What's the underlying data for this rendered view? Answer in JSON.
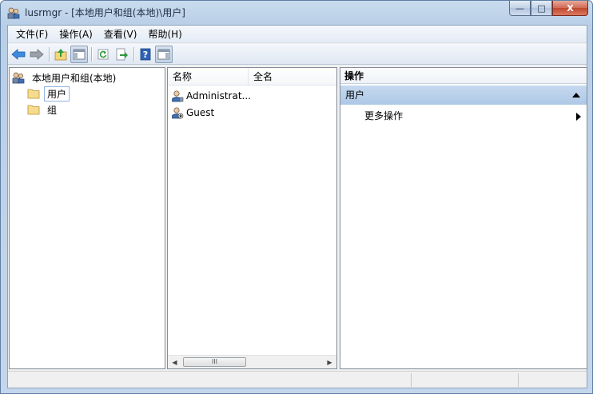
{
  "window": {
    "title": "lusrmgr - [本地用户和组(本地)\\用户]",
    "icon": "users-console-icon",
    "minimize_label": "—",
    "maximize_label": "□",
    "close_label": "X"
  },
  "menu": {
    "items": [
      {
        "label": "文件(F)"
      },
      {
        "label": "操作(A)"
      },
      {
        "label": "查看(V)"
      },
      {
        "label": "帮助(H)"
      }
    ]
  },
  "toolbar": {
    "buttons": [
      "back-icon",
      "forward-icon",
      "up-folder-icon",
      "show-hide-tree-icon",
      "refresh-icon",
      "export-list-icon",
      "help-icon",
      "show-hide-action-pane-icon"
    ]
  },
  "tree": {
    "root": {
      "label": "本地用户和组(本地)",
      "icon": "users-groups-icon"
    },
    "children": [
      {
        "label": "用户",
        "icon": "folder-icon",
        "selected": true
      },
      {
        "label": "组",
        "icon": "folder-icon",
        "selected": false
      }
    ]
  },
  "list": {
    "columns": [
      "名称",
      "全名"
    ],
    "rows": [
      {
        "name": "Administrat...",
        "fullname": "",
        "icon": "user-icon"
      },
      {
        "name": "Guest",
        "fullname": "",
        "icon": "disabled-user-icon"
      }
    ],
    "scroll_thumb": "III"
  },
  "actions": {
    "header": "操作",
    "section": "用户",
    "items": [
      {
        "label": "更多操作"
      }
    ]
  },
  "colors": {
    "selection_border": "#8fb6df",
    "section_bg": "#b8cfea",
    "titlebar": "#c9dbee"
  }
}
